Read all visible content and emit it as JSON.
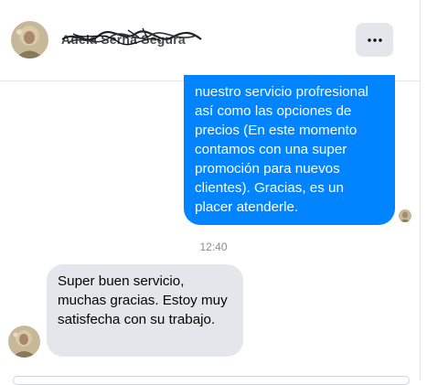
{
  "header": {
    "contact_name": "Adela Serna Segura",
    "menu_icon": "more-horizontal-icon"
  },
  "messages": {
    "outgoing_text": "nuestro servicio profresional así como las opciones de precios (En este momento contamos con una super promoción para nuevos clientes). Gracias, es un placer atenderle.",
    "timestamp": "12:40",
    "incoming_text": "Super buen servicio, muchas gracias. Estoy muy satisfecha con su trabajo."
  },
  "colors": {
    "outgoing_bubble": "#0084ff",
    "incoming_bubble": "#e4e6eb",
    "menu_button": "#e4e6eb"
  }
}
